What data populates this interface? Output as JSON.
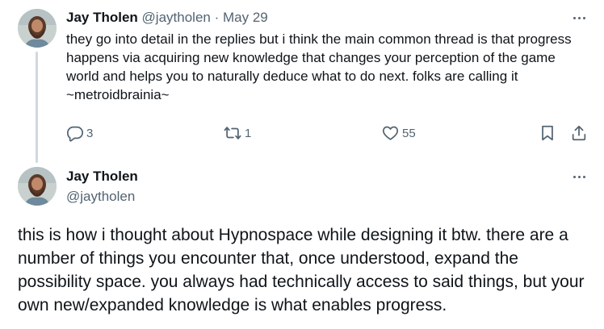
{
  "tweet1": {
    "author_name": "Jay Tholen",
    "handle": "@jaytholen",
    "separator": "·",
    "date": "May 29",
    "text": "they go into detail in the replies but i think the main common thread is that progress happens via acquiring new knowledge that changes your perception of the game world and helps you to naturally deduce what to do next. folks are calling it ~metroidbrainia~",
    "replies": "3",
    "retweets": "1",
    "likes": "55"
  },
  "tweet2": {
    "author_name": "Jay Tholen",
    "handle": "@jaytholen",
    "text": "this is how i thought about Hypnospace while designing it btw. there are a number of things you encounter that, once understood, expand the possibility space. you always had technically access to said things, but your own new/expanded knowledge is what enables progress."
  },
  "icons": {
    "reply": "reply-icon",
    "retweet": "retweet-icon",
    "like": "heart-icon",
    "bookmark": "bookmark-icon",
    "share": "share-icon",
    "more": "more-icon"
  },
  "colors": {
    "text_primary": "#0f1419",
    "text_secondary": "#536471",
    "thread_line": "#cfd9de"
  }
}
